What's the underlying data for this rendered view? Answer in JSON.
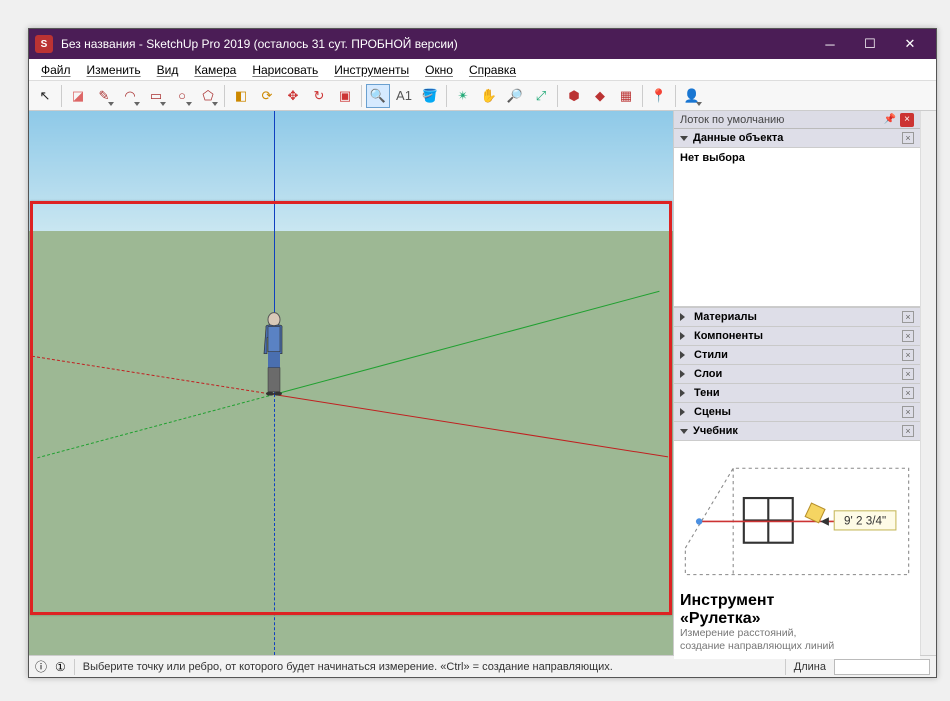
{
  "titlebar": {
    "app_icon_text": "S",
    "title": "Без названия - SketchUp Pro 2019 (осталось 31 сут. ПРОБНОЙ версии)"
  },
  "menu": {
    "items": [
      "Файл",
      "Изменить",
      "Вид",
      "Камера",
      "Нарисовать",
      "Инструменты",
      "Окно",
      "Справка"
    ]
  },
  "toolbar": {
    "tools": [
      {
        "name": "select-tool",
        "glyph": "↖",
        "color": "#222"
      },
      {
        "name": "sep"
      },
      {
        "name": "eraser-tool",
        "glyph": "◪",
        "color": "#d66"
      },
      {
        "name": "pencil-tool",
        "glyph": "✎",
        "color": "#a33",
        "drop": true
      },
      {
        "name": "arc-tool",
        "glyph": "◠",
        "color": "#a33",
        "drop": true
      },
      {
        "name": "rect-tool",
        "glyph": "▭",
        "color": "#a33",
        "drop": true
      },
      {
        "name": "circle-tool",
        "glyph": "○",
        "color": "#a33",
        "drop": true
      },
      {
        "name": "poly-tool",
        "glyph": "⬠",
        "color": "#a33",
        "drop": true
      },
      {
        "name": "sep"
      },
      {
        "name": "pushpull-tool",
        "glyph": "◧",
        "color": "#c80"
      },
      {
        "name": "offset-tool",
        "glyph": "⟳",
        "color": "#c80"
      },
      {
        "name": "move-tool",
        "glyph": "✥",
        "color": "#c33"
      },
      {
        "name": "rotate-tool",
        "glyph": "↻",
        "color": "#c33"
      },
      {
        "name": "scale-tool",
        "glyph": "▣",
        "color": "#c33"
      },
      {
        "name": "sep"
      },
      {
        "name": "tape-tool",
        "glyph": "🔍",
        "color": "#c90",
        "selected": true
      },
      {
        "name": "text-tool",
        "glyph": "A1",
        "color": "#555"
      },
      {
        "name": "paint-tool",
        "glyph": "🪣",
        "color": "#c80"
      },
      {
        "name": "sep"
      },
      {
        "name": "orbit-tool",
        "glyph": "✴",
        "color": "#2a7"
      },
      {
        "name": "pan-tool",
        "glyph": "✋",
        "color": "#2a7"
      },
      {
        "name": "zoom-tool",
        "glyph": "🔎",
        "color": "#2a7"
      },
      {
        "name": "zoom-extents-tool",
        "glyph": "⤢",
        "color": "#2a7"
      },
      {
        "name": "sep"
      },
      {
        "name": "3dwarehouse-icon",
        "glyph": "⬢",
        "color": "#b33"
      },
      {
        "name": "extwarehouse-icon",
        "glyph": "◆",
        "color": "#b33"
      },
      {
        "name": "layout-icon",
        "glyph": "▦",
        "color": "#b33"
      },
      {
        "name": "sep"
      },
      {
        "name": "addloc-icon",
        "glyph": "📍",
        "color": "#b33"
      },
      {
        "name": "sep"
      },
      {
        "name": "signin-icon",
        "glyph": "👤",
        "color": "#888",
        "drop": true
      }
    ]
  },
  "tray": {
    "title": "Лоток по умолчанию",
    "sections": [
      {
        "label": "Данные объекта",
        "open": true,
        "body": "Нет выбора",
        "tall": true
      },
      {
        "label": "Материалы",
        "open": false
      },
      {
        "label": "Компоненты",
        "open": false
      },
      {
        "label": "Стили",
        "open": false
      },
      {
        "label": "Слои",
        "open": false
      },
      {
        "label": "Тени",
        "open": false
      },
      {
        "label": "Сцены",
        "open": false
      },
      {
        "label": "Учебник",
        "open": true,
        "is_instructor": true
      }
    ]
  },
  "instructor": {
    "measure_label": "9' 2 3/4\"",
    "title_1": "Инструмент",
    "title_2": "«Рулетка»",
    "sub_1": "Измерение расстояний,",
    "sub_2": "создание направляющих линий"
  },
  "status": {
    "hint": "Выберите точку или ребро, от которого будет начинаться измерение.  «Ctrl» = создание направляющих.",
    "measure_label": "Длина"
  }
}
